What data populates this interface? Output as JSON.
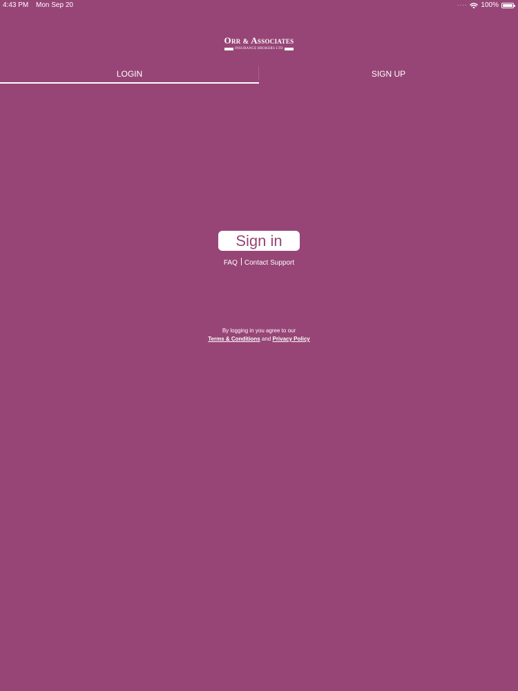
{
  "status_bar": {
    "time": "4:43 PM",
    "date": "Mon Sep 20",
    "signal_icon": "dots-signal-icon",
    "wifi_icon": "wifi-icon",
    "battery_text": "100%",
    "battery_level": 1.0
  },
  "logo": {
    "title_part1": "Orr",
    "ampersand": "&",
    "title_part2": "Associates",
    "subtitle": "INSURANCE BROKERS LTD"
  },
  "tabs": [
    {
      "label": "LOGIN",
      "active": true
    },
    {
      "label": "SIGN UP",
      "active": false
    }
  ],
  "signin": {
    "button_label": "Sign in"
  },
  "help_links": {
    "faq": "FAQ",
    "contact": "Contact Support"
  },
  "legal": {
    "line1": "By logging in you agree to our",
    "terms": "Terms & Conditions",
    "and": "and",
    "privacy": "Privacy Policy"
  },
  "colors": {
    "background": "#974576",
    "text": "#ffffff",
    "button_bg": "#ffffff",
    "button_text": "#974576"
  }
}
